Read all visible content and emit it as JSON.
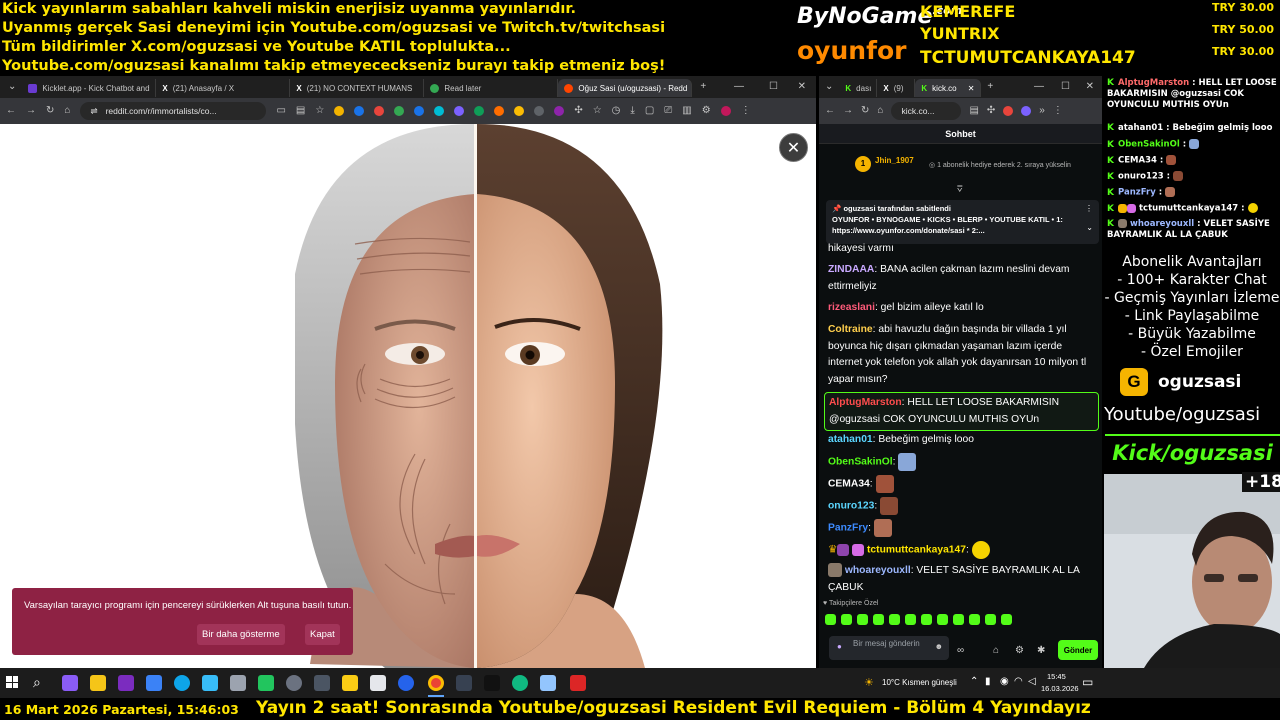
{
  "overlay": {
    "lines": [
      "Kick yayınlarım sabahları kahveli miskin enerjisiz uyanma yayınlarıdır.",
      "Uyanmış gerçek Sasi deneyimi için Youtube.com/oguzsasi ve Twitch.tv/twitchsasi",
      "Tüm bildirimler X.com/oguzsasi ve Youtube KATIL toplulukta...",
      "Youtube.com/oguzsasi kanalımı takip etmeyececkseniz burayı takip etmeniz boş!"
    ],
    "brand1": "ByNoGame",
    "brand1_sub": ".com",
    "brand2": "oyunfor",
    "donors": [
      "KEMEREFE",
      "YUNTRIX",
      "TCTUMUTCANKAYA147"
    ],
    "tries": [
      "TRY 30.00",
      "TRY 50.00",
      "TRY 30.00"
    ],
    "bottom_left": "16 Mart 2026 Pazartesi, 15:46:03",
    "ticker": "Yayın 2 saat! Sonrasında Youtube/oguzsasi Resident Evil Requiem - Bölüm 4 Yayındayız"
  },
  "left_browser": {
    "tabs": [
      "Kicklet.app - Kick Chatbot and",
      "(21) Anasayfa / X",
      "(21) NO CONTEXT HUMANS",
      "Read later",
      "Oğuz Sasi (u/oguzsasi) - Redd"
    ],
    "url": "reddit.com/r/immortalists/co...",
    "toast_message": "Varsayılan tarayıcı programı için pencereyi sürüklerken Alt tuşuna basılı tutun.",
    "toast_btn1": "Bir daha gösterme",
    "toast_btn2": "Kapat"
  },
  "right_browser": {
    "tabs": [
      "dası",
      "(9)",
      "kick.co"
    ],
    "url": "kick.co...",
    "chat_title": "Sohbet",
    "gift_user": "Jhin_1907",
    "gift_text": "1 abonelik hediye ederek 2. sıraya yükselin",
    "gift_rank": "1",
    "pinned_by": "oguzsasi tarafından sabitlendi",
    "pinned_text": "OYUNFOR • BYNOGAME • KICKS • BLERP • YOUTUBE KATIL • 1: https://www.oyunfor.com/donate/sasi * 2:...",
    "messages": [
      {
        "user": "",
        "text": "hikayesi varmı",
        "color": "#ffffff"
      },
      {
        "user": "ZINDAAA",
        "text": "BANA acilen çakman lazım neslini devam ettirmeliyiz",
        "color": "#c9a9ff"
      },
      {
        "user": "rizeaslani",
        "text": "gel bizim aileye katıl lo",
        "color": "#ff5b7a"
      },
      {
        "user": "Coltraine",
        "text": "abi havuzlu dağın başında bir villada 1 yıl boyunca hiç dışarı çıkmadan yaşaman lazım içerde internet yok telefon yok allah yok dayanırsan 10 milyon tl yapar mısın?",
        "color": "#ffcf4d"
      },
      {
        "user": "AlptugMarston",
        "text": "HELL LET LOOSE BAKARMISIN @oguzsasi COK OYUNCULU MUTHIS OYUn",
        "color": "#ff4d4d"
      },
      {
        "user": "atahan01",
        "text": "Bebeğim gelmiş looo",
        "color": "#5bd6ff"
      },
      {
        "user": "ObenSakinOl",
        "text": "",
        "color": "#53fc18"
      },
      {
        "user": "CEMA34",
        "text": "",
        "color": "#ffffff"
      },
      {
        "user": "onuro123",
        "text": "",
        "color": "#5bd6ff"
      },
      {
        "user": "PanzFry",
        "text": "",
        "color": "#3d8bff"
      },
      {
        "user": "tctumuttcankaya147",
        "text": "",
        "color": "#ffe600"
      },
      {
        "user": "whoareyouxll",
        "text": "VELET SASİYE BAYRAMLIK AL LA ÇABUK",
        "color": "#9db8ff"
      }
    ],
    "followers_only": "Takipçilere Özel",
    "input_placeholder": "Bir mesaj gönderin",
    "send": "Gönder"
  },
  "side_chat": [
    {
      "user": "AlptugMarston",
      "text": "HELL LET LOOSE BAKARMISIN @oguzsasi COK OYUNCULU MUTHIS OYUn",
      "color": "#ff6a6a"
    },
    {
      "user": "atahan01",
      "text": "Bebeğim gelmiş looo",
      "color": "#ffffff"
    },
    {
      "user": "ObenSakinOl",
      "text": "",
      "color": "#53fc18"
    },
    {
      "user": "CEMA34",
      "text": "",
      "color": "#ffffff"
    },
    {
      "user": "onuro123",
      "text": "",
      "color": "#ffffff"
    },
    {
      "user": "PanzFry",
      "text": "",
      "color": "#9db8ff"
    },
    {
      "user": "tctumuttcankaya147",
      "text": "",
      "color": "#ffffff"
    },
    {
      "user": "whoareyouxll",
      "text": "VELET SASİYE BAYRAMLIK AL LA ÇABUK",
      "color": "#9db8ff"
    }
  ],
  "benefits": {
    "title": "Abonelik Avantajları",
    "items": [
      "- 100+ Karakter Chat",
      "- Geçmiş Yayınları İzleme",
      "- Link Paylaşabilme",
      "- Büyük Yazabilme",
      "- Özel Emojiler"
    ],
    "kick_user": "oguzsasi",
    "youtube": "Youtube/oguzsasi",
    "kick": "Kick/oguzsasi",
    "age": "+18"
  },
  "taskbar": {
    "weather": "10°C  Kısmen güneşli",
    "time": "15:45",
    "date": "16.03.2026"
  }
}
